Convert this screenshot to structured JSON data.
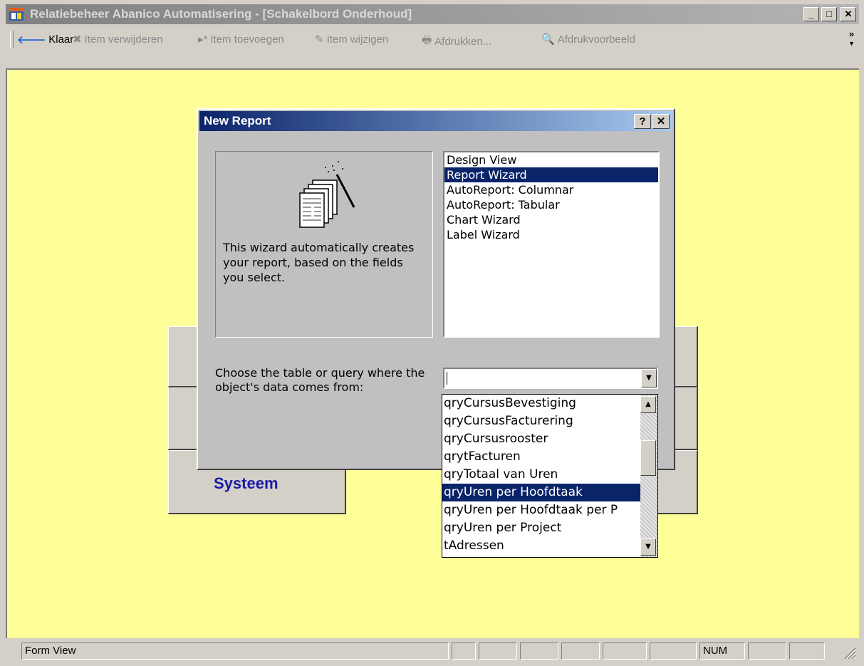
{
  "window": {
    "title": "Relatiebeheer Abanico Automatisering - [Schakelbord Onderhoud]",
    "controls": {
      "minimize": "_",
      "maximize": "□",
      "close": "✕"
    }
  },
  "toolbar": {
    "items": [
      {
        "label": "Klaar",
        "icon": "arrow-left-icon",
        "glyph": "🡐",
        "enabled": true
      },
      {
        "label": "Item verwijderen",
        "icon": "delete-icon",
        "glyph": "✖",
        "enabled": false
      },
      {
        "label": "Item toevoegen",
        "icon": "add-record-icon",
        "glyph": "▸*",
        "enabled": false
      },
      {
        "label": "Item wijzigen",
        "icon": "edit-pencil-icon",
        "glyph": "✎",
        "enabled": false
      },
      {
        "label": "Afdrukken...",
        "icon": "printer-icon",
        "glyph": "🖶",
        "enabled": false
      },
      {
        "label": "Afdrukvoorbeeld",
        "icon": "print-preview-icon",
        "glyph": "🔍",
        "enabled": false
      }
    ],
    "overflow": "»"
  },
  "background": {
    "button_label": "Systeem",
    "colors": {
      "client": "#ffff99",
      "label": "#1a1aa8"
    }
  },
  "dialog": {
    "title": "New Report",
    "help_button": "?",
    "close_button": "✕",
    "description": "This wizard automatically creates your report, based on the fields you select.",
    "options": [
      "Design View",
      "Report Wizard",
      "AutoReport: Columnar",
      "AutoReport: Tabular",
      "Chart Wizard",
      "Label Wizard"
    ],
    "selected_option": "Report Wizard",
    "choose_label": "Choose the table or query where the object's data comes from:",
    "combo_value": ""
  },
  "dropdown": {
    "items": [
      "qryCursusBevestiging",
      "qryCursusFacturering",
      "qryCursusrooster",
      "qrytFacturen",
      "qryTotaal van Uren",
      "qryUren per Hoofdtaak",
      "qryUren per Hoofdtaak per P",
      "qryUren per Project",
      "tAdressen"
    ],
    "selected": "qryUren per Hoofdtaak"
  },
  "statusbar": {
    "view": "Form View",
    "num": "NUM"
  }
}
